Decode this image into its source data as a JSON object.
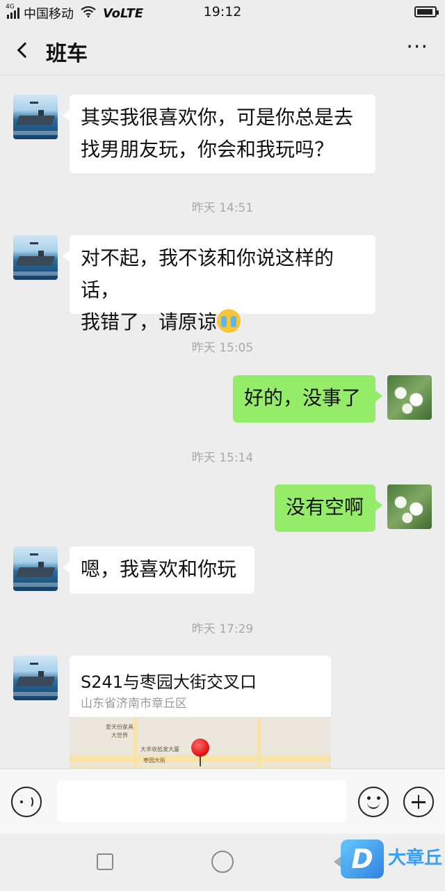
{
  "status_bar": {
    "network_tag": "4G",
    "carrier": "中国移动",
    "volte": "VoLTE",
    "time": "19:12",
    "battery_level": 0.9,
    "icons": [
      "signal-icon",
      "wifi-icon",
      "battery-icon"
    ]
  },
  "header": {
    "title": "班车",
    "back_icon": "chevron-left-icon",
    "more_label": "···"
  },
  "messages": [
    {
      "side": "left",
      "lines": [
        "其实我很喜欢你，可是你总是去",
        "找男朋友玩，你会和我玩吗？"
      ]
    },
    {
      "side": "left",
      "lines": [
        "对不起，我不该和你说这样的话，",
        "我错了，请原谅"
      ],
      "emoji": "crying-face-emoji"
    },
    {
      "side": "right",
      "text": "好的，没事了"
    },
    {
      "side": "right",
      "text": "没有空啊"
    },
    {
      "side": "left",
      "text": "嗯，我喜欢和你玩"
    }
  ],
  "timestamps": [
    "昨天 14:51",
    "昨天 15:05",
    "昨天 15:14",
    "昨天 17:29"
  ],
  "location_card": {
    "title": "S241与枣园大街交叉口",
    "address": "山东省济南市章丘区",
    "map_labels": [
      "爱天份家具",
      "大世界",
      "大丰收抵发大厦",
      "枣园大街"
    ]
  },
  "input_bar": {
    "placeholder": "",
    "icons": [
      "voice-icon",
      "emoji-icon",
      "plus-icon"
    ]
  },
  "nav_bar": {
    "icons": [
      "recent-apps-icon",
      "home-icon",
      "back-icon"
    ]
  },
  "watermark": {
    "logo": "D",
    "text": "大章丘"
  },
  "colors": {
    "background": "#ededed",
    "sent_bubble": "#95ec69",
    "received_bubble": "#ffffff",
    "timestamp_text": "#a8a8a8",
    "pin": "#e31414"
  }
}
